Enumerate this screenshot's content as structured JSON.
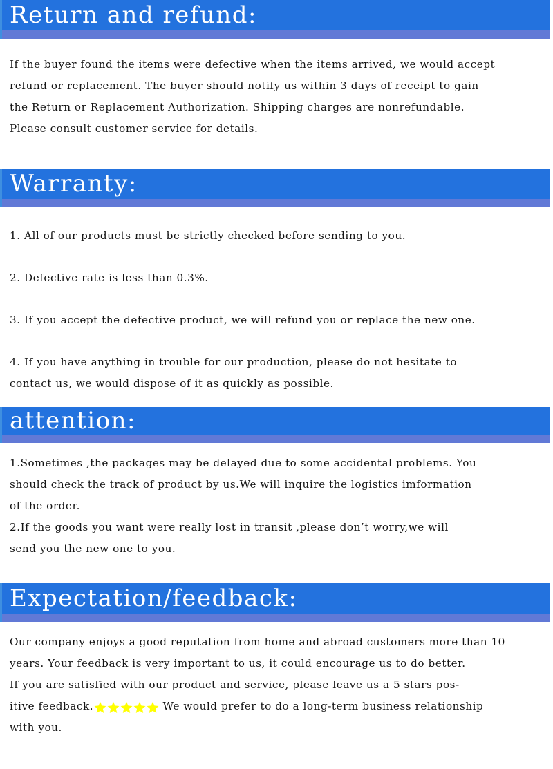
{
  "theme": {
    "header_blue": "#2372de",
    "header_strip": "#6179d6",
    "header_edge": "#3f8fe0",
    "star_yellow": "#ffff00",
    "text_color": "#141414",
    "page_background": "#ffffff"
  },
  "sections": [
    {
      "id": "return-and-refund",
      "title": "Return and refund:",
      "lines": [
        "If the buyer found the items were defective when the items arrived, we would accept",
        "refund or replacement. The buyer should notify us within 3 days of receipt to gain",
        "the Return or Replacement Authorization. Shipping charges are nonrefundable.",
        "Please consult customer service for details."
      ]
    },
    {
      "id": "warranty",
      "title": "Warranty:",
      "items": [
        {
          "number": "1.",
          "lines": [
            "1. All of our products must be strictly checked before sending to you."
          ]
        },
        {
          "number": "2.",
          "lines": [
            "2. Defective rate is less than 0.3%."
          ]
        },
        {
          "number": "3.",
          "lines": [
            "3. If you accept the defective product, we will refund you or replace the new one."
          ]
        },
        {
          "number": "4.",
          "lines": [
            "4. If you have anything in trouble for our production, please do not hesitate to",
            "contact us, we would dispose of it as quickly as possible."
          ]
        }
      ]
    },
    {
      "id": "attention",
      "title": "attention:",
      "items": [
        {
          "number": "1.",
          "lines": [
            "1.Sometimes ,the packages may be delayed due to some accidental problems. You",
            "should check the track of product by us.We will inquire the logistics imformation",
            "of the order."
          ]
        },
        {
          "number": "2.",
          "lines": [
            "2.If the goods you want were really lost in transit ,please don’t worry,we will",
            "send you the new one to you."
          ]
        }
      ]
    },
    {
      "id": "expectation-feedback",
      "title": "Expectation/feedback:",
      "lines": [
        "Our company enjoys a good reputation from home and abroad customers more than 10",
        "years. Your feedback is very important to us, it could encourage us to do better.",
        "If you are satisfied with our product and service, please leave us a 5 stars pos-"
      ],
      "star_line": {
        "before_stars": "itive feedback.",
        "star_count": 5,
        "star_icon": "star-icon",
        "after_stars": " We would prefer to do a long-term business relationship"
      },
      "final_line": "with you."
    }
  ]
}
